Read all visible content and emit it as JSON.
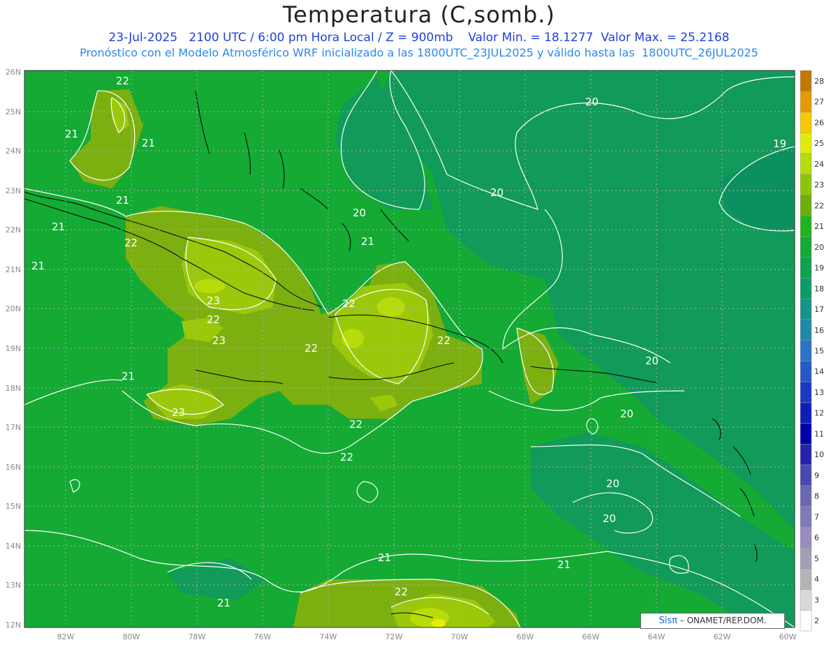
{
  "header": {
    "title": "Temperatura (C,somb.)",
    "line1_date": "23-Jul-2025",
    "line1_time": "2100 UTC / 6:00 pm Hora Local / Z = 900mb",
    "line1_min": "Valor Min. = 18.1277",
    "line1_max": "Valor Max. = 25.2168",
    "line2": "Pronóstico con el Modelo Atmosférico WRF inicializado a las 1800UTC_23JUL2025 y válido hasta las  1800UTC_26JUL2025"
  },
  "axes": {
    "lon_labels": [
      "82W",
      "80W",
      "78W",
      "76W",
      "74W",
      "72W",
      "70W",
      "68W",
      "66W",
      "64W",
      "62W",
      "60W"
    ],
    "lat_labels": [
      "26N",
      "25N",
      "24N",
      "23N",
      "22N",
      "21N",
      "20N",
      "19N",
      "18N",
      "17N",
      "16N",
      "15N",
      "14N",
      "13N",
      "12N"
    ]
  },
  "colorbar": {
    "levels": [
      "2",
      "3",
      "4",
      "5",
      "6",
      "7",
      "8",
      "9",
      "10",
      "11",
      "12",
      "13",
      "14",
      "15",
      "16",
      "17",
      "18",
      "19",
      "20",
      "21",
      "22",
      "23",
      "24",
      "25",
      "26",
      "27",
      "28"
    ],
    "colors": [
      "#ffffff",
      "#d8d8d8",
      "#b4b4b4",
      "#a0a0b4",
      "#9a8cc0",
      "#7f7ab8",
      "#6a68b4",
      "#4848b0",
      "#2424aa",
      "#0000a8",
      "#0e1cb8",
      "#1a38c4",
      "#2858c8",
      "#2a74c4",
      "#1e8aaa",
      "#14948a",
      "#0c9c6c",
      "#0ea250",
      "#14aa34",
      "#20b420",
      "#6cae10",
      "#8ec408",
      "#b6dc0a",
      "#e0ec08",
      "#f6c800",
      "#e49a00",
      "#c07800"
    ]
  },
  "contour_labels": [
    "22",
    "21",
    "21",
    "21",
    "21",
    "22",
    "21",
    "23",
    "22",
    "23",
    "22",
    "21",
    "23",
    "22",
    "22",
    "22",
    "22",
    "21",
    "20",
    "20",
    "20",
    "19",
    "20",
    "20",
    "20",
    "20",
    "21",
    "21",
    "22",
    "21"
  ],
  "credit": {
    "brand": "Sisπ",
    "org": "– ONAMET/REP.DOM."
  },
  "colors": {
    "background_field": "#14aa34",
    "warm_field": "#7cb010",
    "cool_field": "#119a5a",
    "contour": "#ffffff",
    "coast": "#000000"
  }
}
